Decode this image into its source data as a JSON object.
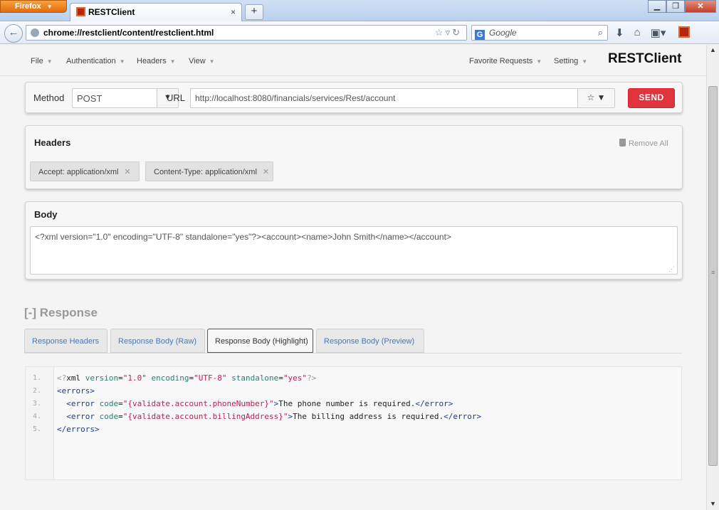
{
  "browser": {
    "app_button": "Firefox",
    "tab_title": "RESTClient",
    "tab_close": "×",
    "new_tab": "+",
    "url": "chrome://restclient/content/restclient.html",
    "search_engine": "G",
    "search_placeholder": "Google"
  },
  "menu": {
    "file": "File",
    "authentication": "Authentication",
    "headers": "Headers",
    "view": "View",
    "favorites": "Favorite Requests",
    "setting": "Setting",
    "brand": "RESTClient"
  },
  "request": {
    "method_label": "Method",
    "method": "POST",
    "url_label": "URL",
    "url": "http://localhost:8080/financials/services/Rest/account",
    "send": "SEND"
  },
  "headers": {
    "title": "Headers",
    "remove_all": "Remove All",
    "items": [
      {
        "label": "Accept: application/xml"
      },
      {
        "label": "Content-Type: application/xml"
      }
    ]
  },
  "body": {
    "title": "Body",
    "content": "<?xml version=\"1.0\" encoding=\"UTF-8\" standalone=\"yes\"?><account><name>John Smith</name></account>"
  },
  "response": {
    "title": "[-] Response",
    "tabs": [
      {
        "label": "Response Headers"
      },
      {
        "label": "Response Body (Raw)"
      },
      {
        "label": "Response Body (Highlight)"
      },
      {
        "label": "Response Body (Preview)"
      }
    ],
    "active_tab": 2,
    "code": {
      "line_numbers": [
        "1.",
        "2.",
        "3.",
        "4.",
        "5."
      ],
      "pi_open": "<?",
      "pi_name": "xml",
      "a_version": "version",
      "v_version": "\"1.0\"",
      "a_encoding": "encoding",
      "v_encoding": "\"UTF-8\"",
      "a_standalone": "standalone",
      "v_standalone": "\"yes\"",
      "pi_close": "?>",
      "errors_open": "<errors>",
      "error_tag_open": "<error",
      "a_code": "code",
      "v_code_1": "\"{validate.account.phoneNumber}\"",
      "text_1": "The phone number is required.",
      "v_code_2": "\"{validate.account.billingAddress}\"",
      "text_2": "The billing address is required.",
      "error_tag_close": "</error>",
      "errors_close": "</errors>"
    }
  }
}
